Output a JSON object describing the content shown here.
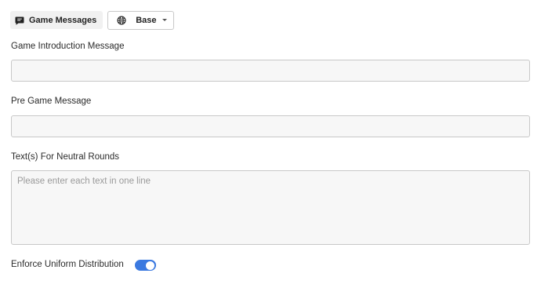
{
  "toolbar": {
    "game_messages_label": "Game Messages",
    "game_messages_icon": "message-icon",
    "language_value": "Base",
    "language_icon": "globe-icon"
  },
  "fields": {
    "intro": {
      "label": "Game Introduction Message",
      "value": "",
      "placeholder": ""
    },
    "pre_game": {
      "label": "Pre Game Message",
      "value": "",
      "placeholder": ""
    },
    "neutral": {
      "label": "Text(s) For Neutral Rounds",
      "value": "",
      "placeholder": "Please enter each text in one line"
    }
  },
  "uniform": {
    "label": "Enforce Uniform Distribution",
    "enabled": true
  },
  "colors": {
    "accent": "#3b79e0",
    "field_background": "#f7f7f7",
    "field_border": "#c8c8c8"
  }
}
